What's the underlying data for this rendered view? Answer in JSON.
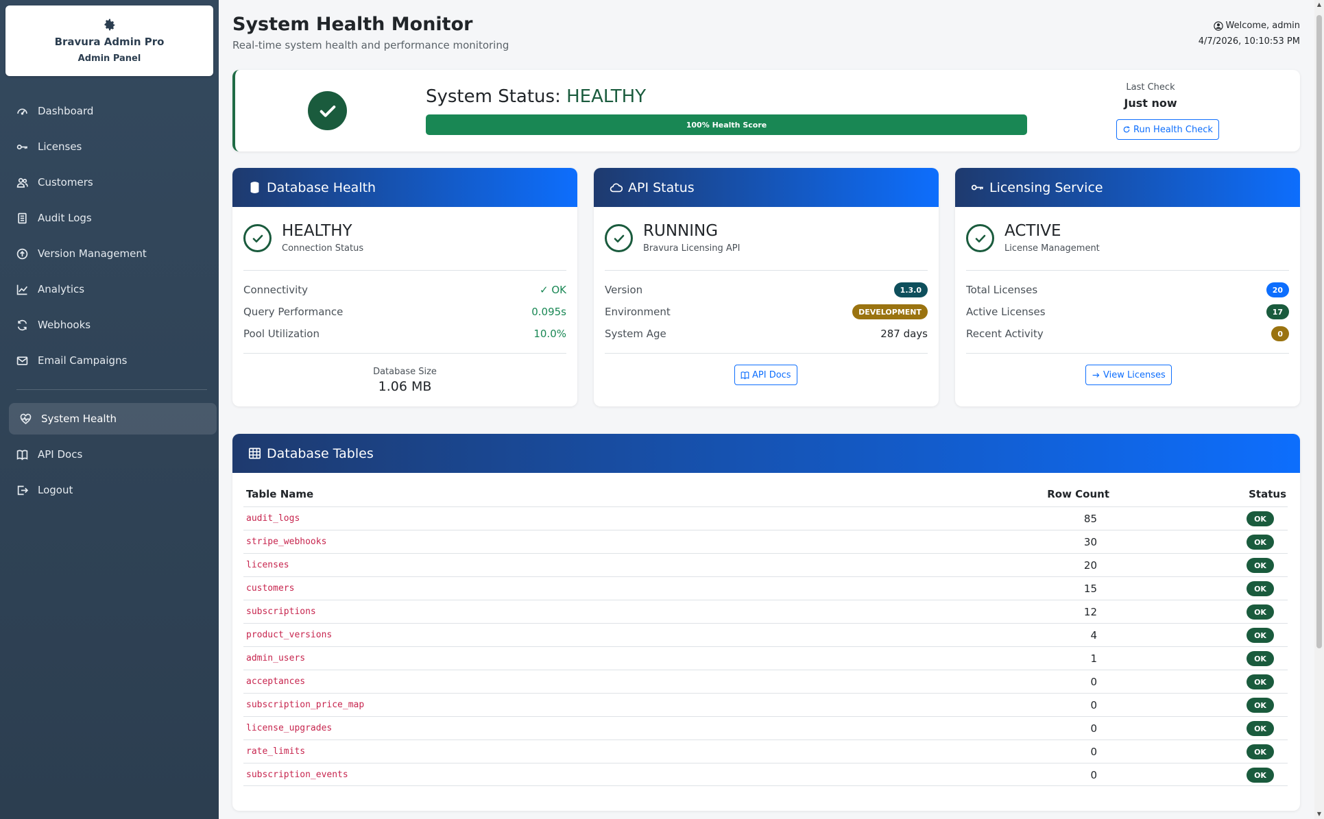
{
  "sidebar": {
    "brand_title": "Bravura Admin Pro",
    "brand_sub": "Admin Panel",
    "items": [
      {
        "label": "Dashboard",
        "icon": "dashboard-icon"
      },
      {
        "label": "Licenses",
        "icon": "key-icon"
      },
      {
        "label": "Customers",
        "icon": "users-icon"
      },
      {
        "label": "Audit Logs",
        "icon": "journal-icon"
      },
      {
        "label": "Version Management",
        "icon": "upload-icon"
      },
      {
        "label": "Analytics",
        "icon": "chart-icon"
      },
      {
        "label": "Webhooks",
        "icon": "refresh-icon"
      },
      {
        "label": "Email Campaigns",
        "icon": "envelope-icon"
      },
      {
        "label": "System Health",
        "icon": "heart-pulse-icon"
      },
      {
        "label": "API Docs",
        "icon": "book-icon"
      },
      {
        "label": "Logout",
        "icon": "logout-icon"
      }
    ],
    "active_item": "System Health"
  },
  "header": {
    "title": "System Health Monitor",
    "subtitle": "Real-time system health and performance monitoring",
    "welcome": "Welcome, admin",
    "datetime": "4/7/2026, 10:10:53 PM"
  },
  "status": {
    "label": "System Status: ",
    "value": "HEALTHY",
    "health_score_text": "100% Health Score",
    "health_score": 100,
    "last_check_label": "Last Check",
    "last_check_value": "Just now",
    "run_button": "Run Health Check"
  },
  "database": {
    "title": "Database Health",
    "status": "HEALTHY",
    "status_sub": "Connection Status",
    "rows": [
      {
        "label": "Connectivity",
        "value": "✓ OK"
      },
      {
        "label": "Query Performance",
        "value": "0.095s"
      },
      {
        "label": "Pool Utilization",
        "value": "10.0%"
      }
    ],
    "size_label": "Database Size",
    "size_value": "1.06 MB"
  },
  "api": {
    "title": "API Status",
    "status": "RUNNING",
    "status_sub": "Bravura Licensing API",
    "version_label": "Version",
    "version_value": "1.3.0",
    "env_label": "Environment",
    "env_value": "DEVELOPMENT",
    "age_label": "System Age",
    "age_value": "287 days",
    "button": "API Docs"
  },
  "licensing": {
    "title": "Licensing Service",
    "status": "ACTIVE",
    "status_sub": "License Management",
    "total_label": "Total Licenses",
    "total_value": "20",
    "active_label": "Active Licenses",
    "active_value": "17",
    "recent_label": "Recent Activity",
    "recent_value": "0",
    "button": "View Licenses"
  },
  "tables": {
    "title": "Database Tables",
    "headers": {
      "name": "Table Name",
      "count": "Row Count",
      "status": "Status"
    },
    "rows": [
      {
        "name": "audit_logs",
        "count": "85",
        "status": "OK"
      },
      {
        "name": "stripe_webhooks",
        "count": "30",
        "status": "OK"
      },
      {
        "name": "licenses",
        "count": "20",
        "status": "OK"
      },
      {
        "name": "customers",
        "count": "15",
        "status": "OK"
      },
      {
        "name": "subscriptions",
        "count": "12",
        "status": "OK"
      },
      {
        "name": "product_versions",
        "count": "4",
        "status": "OK"
      },
      {
        "name": "admin_users",
        "count": "1",
        "status": "OK"
      },
      {
        "name": "acceptances",
        "count": "0",
        "status": "OK"
      },
      {
        "name": "subscription_price_map",
        "count": "0",
        "status": "OK"
      },
      {
        "name": "license_upgrades",
        "count": "0",
        "status": "OK"
      },
      {
        "name": "rate_limits",
        "count": "0",
        "status": "OK"
      },
      {
        "name": "subscription_events",
        "count": "0",
        "status": "OK"
      }
    ]
  },
  "colors": {
    "sidebar_bg": "#2c3e50",
    "accent": "#0d6efd",
    "success": "#198754",
    "dark_success": "#1a5b3d",
    "code_pink": "#c7254e"
  }
}
